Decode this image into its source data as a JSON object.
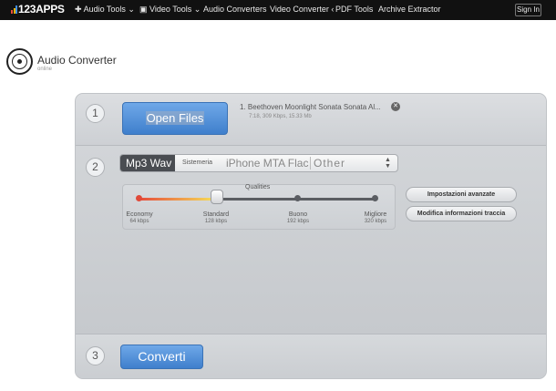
{
  "topbar": {
    "logo": "123APPS",
    "nav": [
      {
        "label": "Audio Tools ⌄"
      },
      {
        "label": "Video Tools ⌄"
      },
      {
        "label": "Audio Converters"
      },
      {
        "label": "Video Converter ‹"
      },
      {
        "label": "PDF Tools"
      },
      {
        "label": "Archive Extractor"
      }
    ],
    "signin": "Sign In"
  },
  "header": {
    "title": "Audio Converter",
    "subtitle": "online"
  },
  "step1": {
    "number": "1",
    "open_files": "Open Files",
    "file_name": "1. Beethoven Moonlight Sonata Sonata Al...",
    "file_meta": "7:18, 309 Kbps, 15.33 Mb"
  },
  "step2": {
    "number": "2",
    "format_active": "Mp3 Wav",
    "format_settings": "Sistemeria",
    "format_list": "iPhone MTA Flac",
    "format_other": "Other",
    "quality_label": "Qualities",
    "quality_levels": [
      {
        "name": "Economy",
        "rate": "64 kbps"
      },
      {
        "name": "Standard",
        "rate": "128 kbps"
      },
      {
        "name": "Buono",
        "rate": "192 kbps"
      },
      {
        "name": "Migliore",
        "rate": "320 kbps"
      }
    ],
    "selected_quality_fraction": 0.33,
    "advanced_button": "Impostazioni avanzate",
    "metadata_button": "Modifica informazioni traccia"
  },
  "step3": {
    "number": "3",
    "convert": "Converti"
  },
  "colors": {
    "topbar_bg": "#111111",
    "accent_blue": "#4f8ed8",
    "panel_bg": "#cfd2d6"
  }
}
